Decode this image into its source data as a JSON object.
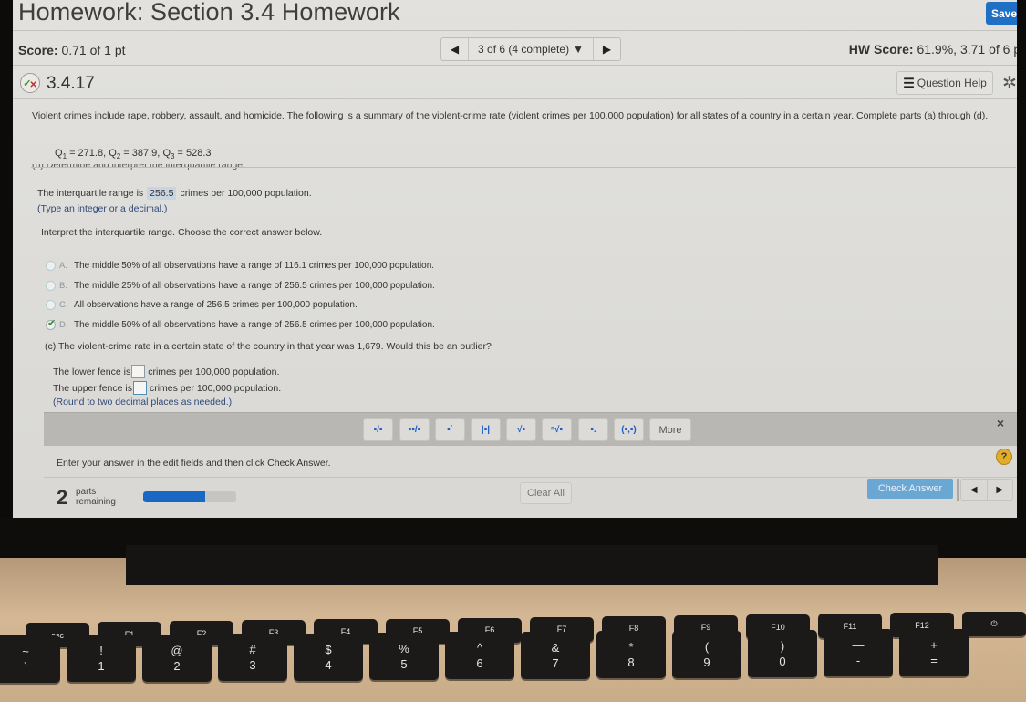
{
  "header": {
    "title": "Homework: Section 3.4 Homework",
    "save_label": "Save"
  },
  "score_bar": {
    "score_label": "Score:",
    "score_value": "0.71 of 1 pt",
    "pager_label": "3 of 6 (4 complete)",
    "pager_dropdown_icon": "caret-down",
    "prev_icon": "triangle-left",
    "next_icon": "triangle-right",
    "hw_score_label": "HW Score:",
    "hw_score_value": "61.9%, 3.71 of 6 pt"
  },
  "question_bar": {
    "status_icon": "partial-credit-check-x",
    "question_id": "3.4.17",
    "help_label": "Question Help",
    "help_icon": "list-icon",
    "settings_icon": "gear"
  },
  "question": {
    "intro": "Violent crimes include rape, robbery, assault, and homicide. The following is a summary of the violent-crime rate (violent crimes per 100,000 population) for all states of a country in a certain year. Complete parts (a) through (d).",
    "q1_label": "Q",
    "q1_sub": "1",
    "q1_value": "= 271.8,",
    "q2_label": "Q",
    "q2_sub": "2",
    "q2_value": "= 387.9,",
    "q3_label": "Q",
    "q3_sub": "3",
    "q3_value": "= 528.3",
    "part_b_heading": "(b) Determine and interpret the interquartile range.",
    "iqr_prefix": "The interquartile range is",
    "iqr_value": "256.5",
    "iqr_suffix": "crimes per 100,000 population.",
    "iqr_hint": "(Type an integer or a decimal.)",
    "interpret_prompt": "Interpret the interquartile range. Choose the correct answer below.",
    "options": [
      {
        "letter": "A.",
        "text": "The middle 50% of all observations have a range of 116.1 crimes per 100,000 population.",
        "selected": false
      },
      {
        "letter": "B.",
        "text": "The middle 25% of all observations have a range of 256.5 crimes per 100,000 population.",
        "selected": false
      },
      {
        "letter": "C.",
        "text": "All observations have a range of 256.5 crimes per 100,000 population.",
        "selected": false
      },
      {
        "letter": "D.",
        "text": "The middle 50% of all observations have a range of 256.5 crimes per 100,000 population.",
        "selected": true
      }
    ],
    "part_c": "(c) The violent-crime rate in a certain state of the country in that year was 1,679. Would this be an outlier?",
    "lower_fence_prefix": "The lower fence is",
    "lower_fence_value": "",
    "lower_fence_suffix": "crimes per 100,000 population.",
    "upper_fence_prefix": "The upper fence is",
    "upper_fence_value": "",
    "upper_fence_suffix": "crimes per 100,000 population.",
    "round_hint": "(Round to two decimal places as needed.)"
  },
  "math_toolbar": {
    "buttons": [
      {
        "name": "fraction",
        "glyph": "▪/▪"
      },
      {
        "name": "mixed-number",
        "glyph": "▪▪/▪"
      },
      {
        "name": "exponent",
        "glyph": "▪˙"
      },
      {
        "name": "absolute-value",
        "glyph": "|▪|"
      },
      {
        "name": "square-root",
        "glyph": "√▪"
      },
      {
        "name": "nth-root",
        "glyph": "ⁿ√▪"
      },
      {
        "name": "subscript",
        "glyph": "▪."
      },
      {
        "name": "ordered-pair",
        "glyph": "(▪,▪)"
      },
      {
        "name": "more",
        "glyph": "More"
      }
    ],
    "close_icon": "×"
  },
  "footer": {
    "instruction": "Enter your answer in the edit fields and then click Check Answer.",
    "help_icon": "?",
    "parts_count": "2",
    "parts_label_1": "parts",
    "parts_label_2": "remaining",
    "progress_fraction": 0.67,
    "clear_all_label": "Clear All",
    "check_answer_label": "Check Answer",
    "prev_icon": "◀",
    "next_icon": "▶"
  },
  "keyboard": {
    "function_keys": [
      "esc",
      "F1",
      "F2",
      "F3",
      "F4",
      "F5",
      "F6",
      "F7",
      "F8",
      "F9",
      "F10",
      "F11",
      "F12",
      "⏻"
    ],
    "number_keys": [
      {
        "top": "~",
        "bottom": "`"
      },
      {
        "top": "!",
        "bottom": "1"
      },
      {
        "top": "@",
        "bottom": "2"
      },
      {
        "top": "#",
        "bottom": "3"
      },
      {
        "top": "$",
        "bottom": "4"
      },
      {
        "top": "%",
        "bottom": "5"
      },
      {
        "top": "^",
        "bottom": "6"
      },
      {
        "top": "&",
        "bottom": "7"
      },
      {
        "top": "*",
        "bottom": "8"
      },
      {
        "top": "(",
        "bottom": "9"
      },
      {
        "top": ")",
        "bottom": "0"
      },
      {
        "top": "—",
        "bottom": "-"
      },
      {
        "top": "+",
        "bottom": "="
      }
    ]
  }
}
